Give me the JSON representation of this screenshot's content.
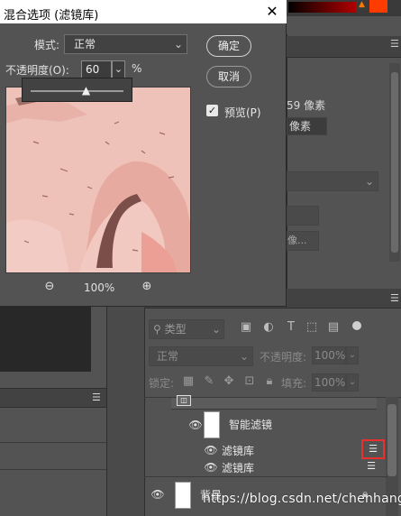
{
  "dialog": {
    "title": "混合选项 (滤镜库)",
    "close_glyph": "✕",
    "mode_label": "模式:",
    "mode_value": "正常",
    "opacity_label": "不透明度(O):",
    "opacity_value": "60",
    "opacity_unit": "%",
    "opacity_slider_level": 0.6,
    "ok_label": "确定",
    "cancel_label": "取消",
    "preview_label": "预览(P)",
    "preview_checked": true,
    "zoom_value": "100%"
  },
  "properties_panel": {
    "size_text": "59 像素",
    "unit_text": "像素",
    "button_text": "像..."
  },
  "layers_panel": {
    "kind_label": "类型",
    "blend_mode": "正常",
    "opacity_label": "不透明度:",
    "opacity_value": "100%",
    "lock_label": "锁定:",
    "fill_label": "填充:",
    "fill_value": "100%",
    "smart_filters_label": "智能滤镜",
    "filters": [
      {
        "name": "滤镜库"
      },
      {
        "name": "滤镜库"
      }
    ],
    "background_layer": "背景"
  },
  "watermark": "https://blog.csdn.net/chenhangx",
  "colors": {
    "panel_bg": "#535353",
    "header_bg": "#424242",
    "highlight_border": "#e8302f",
    "preview_pink": "#f0c3bb"
  }
}
